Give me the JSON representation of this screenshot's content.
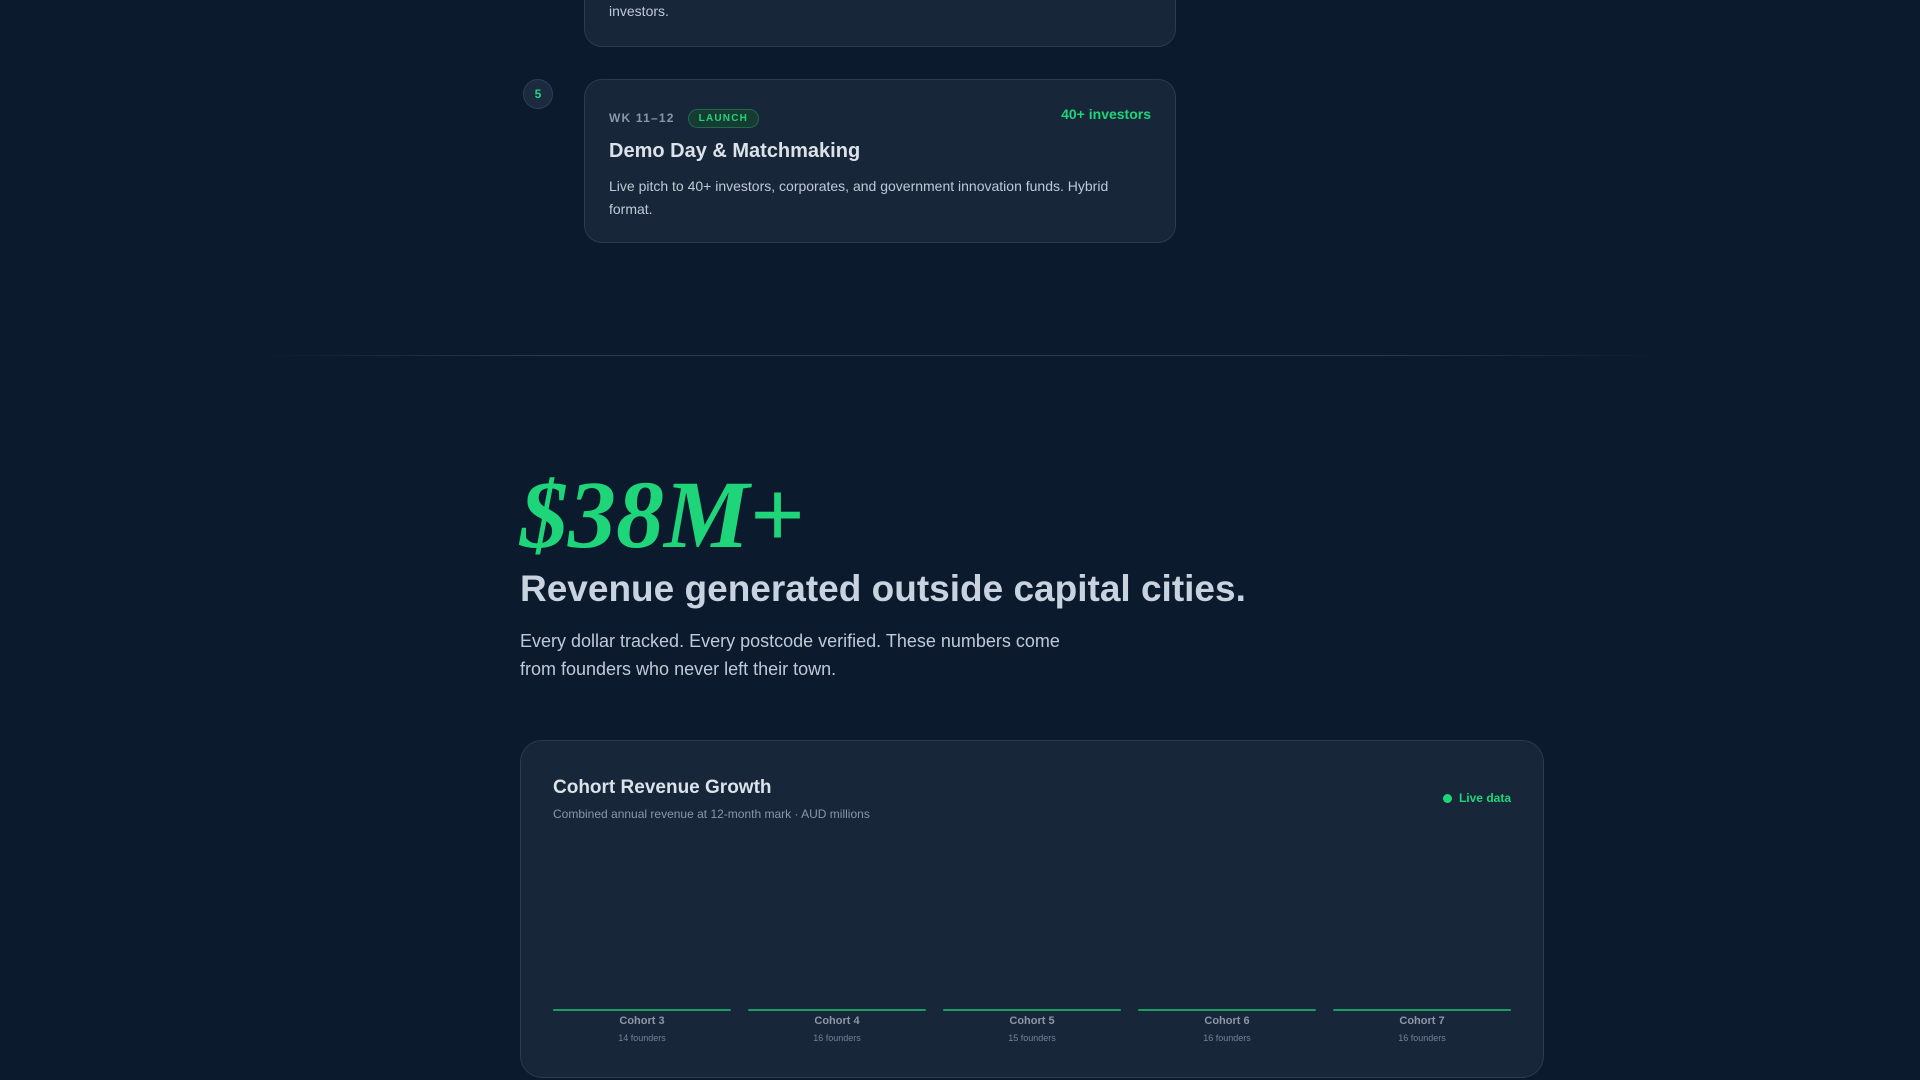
{
  "timeline": {
    "prev_step": {
      "description_tail": "investors."
    },
    "step": {
      "number": "5",
      "week": "WK 11–12",
      "badge": "LAUNCH",
      "highlight": "40+ investors",
      "title": "Demo Day & Matchmaking",
      "description": "Live pitch to 40+ investors, corporates, and government innovation funds. Hybrid format."
    }
  },
  "stat": {
    "value": "$38M+",
    "headline": "Revenue generated outside capital cities.",
    "lead": "Every dollar tracked. Every postcode verified. These numbers come from founders who never left their town."
  },
  "chart_card": {
    "live_label": "Live data",
    "accent_color": "#1ed57a"
  },
  "chart_data": {
    "type": "bar",
    "title": "Cohort Revenue Growth",
    "subtitle": "Combined annual revenue at 12-month mark · AUD millions",
    "categories": [
      "Cohort 3",
      "Cohort 4",
      "Cohort 5",
      "Cohort 6",
      "Cohort 7"
    ],
    "founders": [
      "14 founders",
      "16 founders",
      "15 founders",
      "16 founders",
      "16 founders"
    ],
    "values": [
      0,
      0,
      0,
      0,
      0
    ],
    "ylim": [
      0,
      10
    ],
    "grid": false,
    "legend": "none"
  }
}
